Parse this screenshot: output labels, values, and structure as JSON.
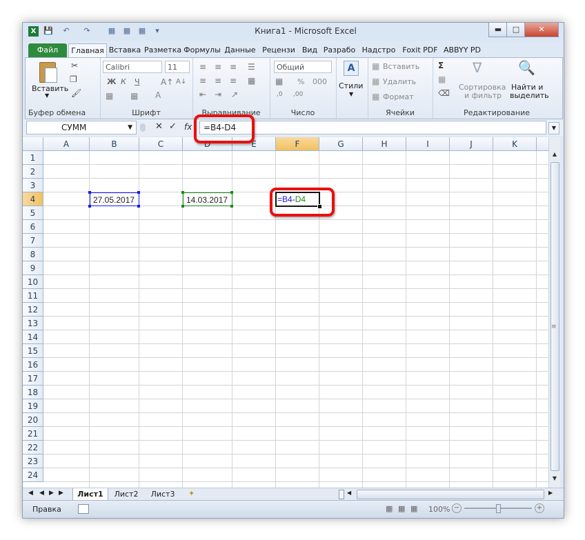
{
  "window": {
    "title": "Книга1  -  Microsoft Excel"
  },
  "ribbon_tabs": [
    "Файл",
    "Главная",
    "Вставка",
    "Разметка",
    "Формулы",
    "Данные",
    "Рецензи",
    "Вид",
    "Разрабо",
    "Надстро",
    "Foxit PDF",
    "ABBYY PD"
  ],
  "ribbon": {
    "clipboard": {
      "paste": "Вставить",
      "label": "Буфер обмена"
    },
    "font": {
      "name": "Calibri",
      "size": "11",
      "label": "Шрифт",
      "bold": "Ж",
      "italic": "К",
      "underline": "Ч"
    },
    "alignment": {
      "label": "Выравнивание"
    },
    "number": {
      "format": "Общий",
      "label": "Число",
      "percent": "%",
      "thousands": "000"
    },
    "styles": {
      "label": "Стили"
    },
    "cells": {
      "insert": "Вставить",
      "delete": "Удалить",
      "format": "Формат",
      "label": "Ячейки"
    },
    "editing": {
      "sort": "Сортировка",
      "sort2": "и фильтр",
      "find": "Найти и",
      "find2": "выделить",
      "label": "Редактирование"
    }
  },
  "formula_bar": {
    "name_box": "СУММ",
    "fx": "fx",
    "formula": "=B4-D4"
  },
  "grid": {
    "columns": [
      "A",
      "B",
      "C",
      "D",
      "E",
      "F",
      "G",
      "H",
      "I",
      "J",
      "K"
    ],
    "rows": [
      "1",
      "2",
      "3",
      "4",
      "5",
      "6",
      "7",
      "8",
      "9",
      "10",
      "11",
      "12",
      "13",
      "14",
      "15",
      "16",
      "17",
      "18",
      "19",
      "20",
      "21",
      "22",
      "23",
      "24"
    ],
    "b4": "27.05.2017",
    "d4": "14.03.2017",
    "f4_ref1": "=B4",
    "f4_op": "-",
    "f4_ref2": "D4"
  },
  "sheets": [
    "Лист1",
    "Лист2",
    "Лист3"
  ],
  "status": {
    "mode": "Правка",
    "zoom": "100%"
  },
  "colors": {
    "accent_red": "#e81010",
    "file_tab": "#2e8b3d",
    "ref_blue": "#1a1ae6",
    "ref_green": "#1b8a1b",
    "selected_header": "#f1c15f"
  }
}
